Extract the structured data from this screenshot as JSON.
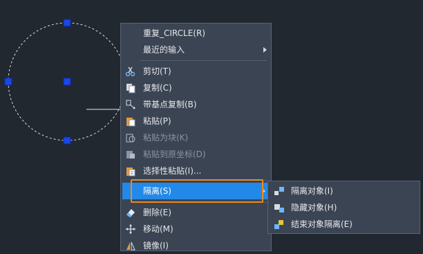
{
  "menu": {
    "items": [
      {
        "label": "重复_CIRCLE(R)",
        "icon": "",
        "disabled": false,
        "has_sub": false
      },
      {
        "label": "最近的输入",
        "icon": "",
        "disabled": false,
        "has_sub": true
      },
      {
        "label": "剪切(T)",
        "icon": "scissors-icon",
        "disabled": false,
        "has_sub": false
      },
      {
        "label": "复制(C)",
        "icon": "copy-icon",
        "disabled": false,
        "has_sub": false
      },
      {
        "label": "带基点复制(B)",
        "icon": "copy-base-point-icon",
        "disabled": false,
        "has_sub": false
      },
      {
        "label": "粘贴(P)",
        "icon": "paste-icon",
        "disabled": false,
        "has_sub": false
      },
      {
        "label": "粘贴为块(K)",
        "icon": "paste-block-icon",
        "disabled": true,
        "has_sub": false
      },
      {
        "label": "粘贴到原坐标(D)",
        "icon": "paste-origin-icon",
        "disabled": true,
        "has_sub": false
      },
      {
        "label": "选择性粘贴(I)...",
        "icon": "paste-special-icon",
        "disabled": false,
        "has_sub": false
      },
      {
        "label": "隔离(S)",
        "icon": "",
        "disabled": false,
        "has_sub": true
      },
      {
        "label": "删除(E)",
        "icon": "eraser-icon",
        "disabled": false,
        "has_sub": false
      },
      {
        "label": "移动(M)",
        "icon": "move-icon",
        "disabled": false,
        "has_sub": false
      },
      {
        "label": "镜像(I)",
        "icon": "mirror-icon",
        "disabled": false,
        "has_sub": false
      }
    ]
  },
  "submenu": {
    "items": [
      {
        "label": "隔离对象(I)",
        "icon": "isolate-object-icon"
      },
      {
        "label": "隐藏对象(H)",
        "icon": "hide-object-icon"
      },
      {
        "label": "结束对象隔离(E)",
        "icon": "end-isolation-icon"
      }
    ]
  },
  "colors": {
    "background": "#212830",
    "menu": "#3b4453",
    "highlight": "#2389e8",
    "focus": "#f08a1a",
    "grip": "#1a47e6"
  }
}
